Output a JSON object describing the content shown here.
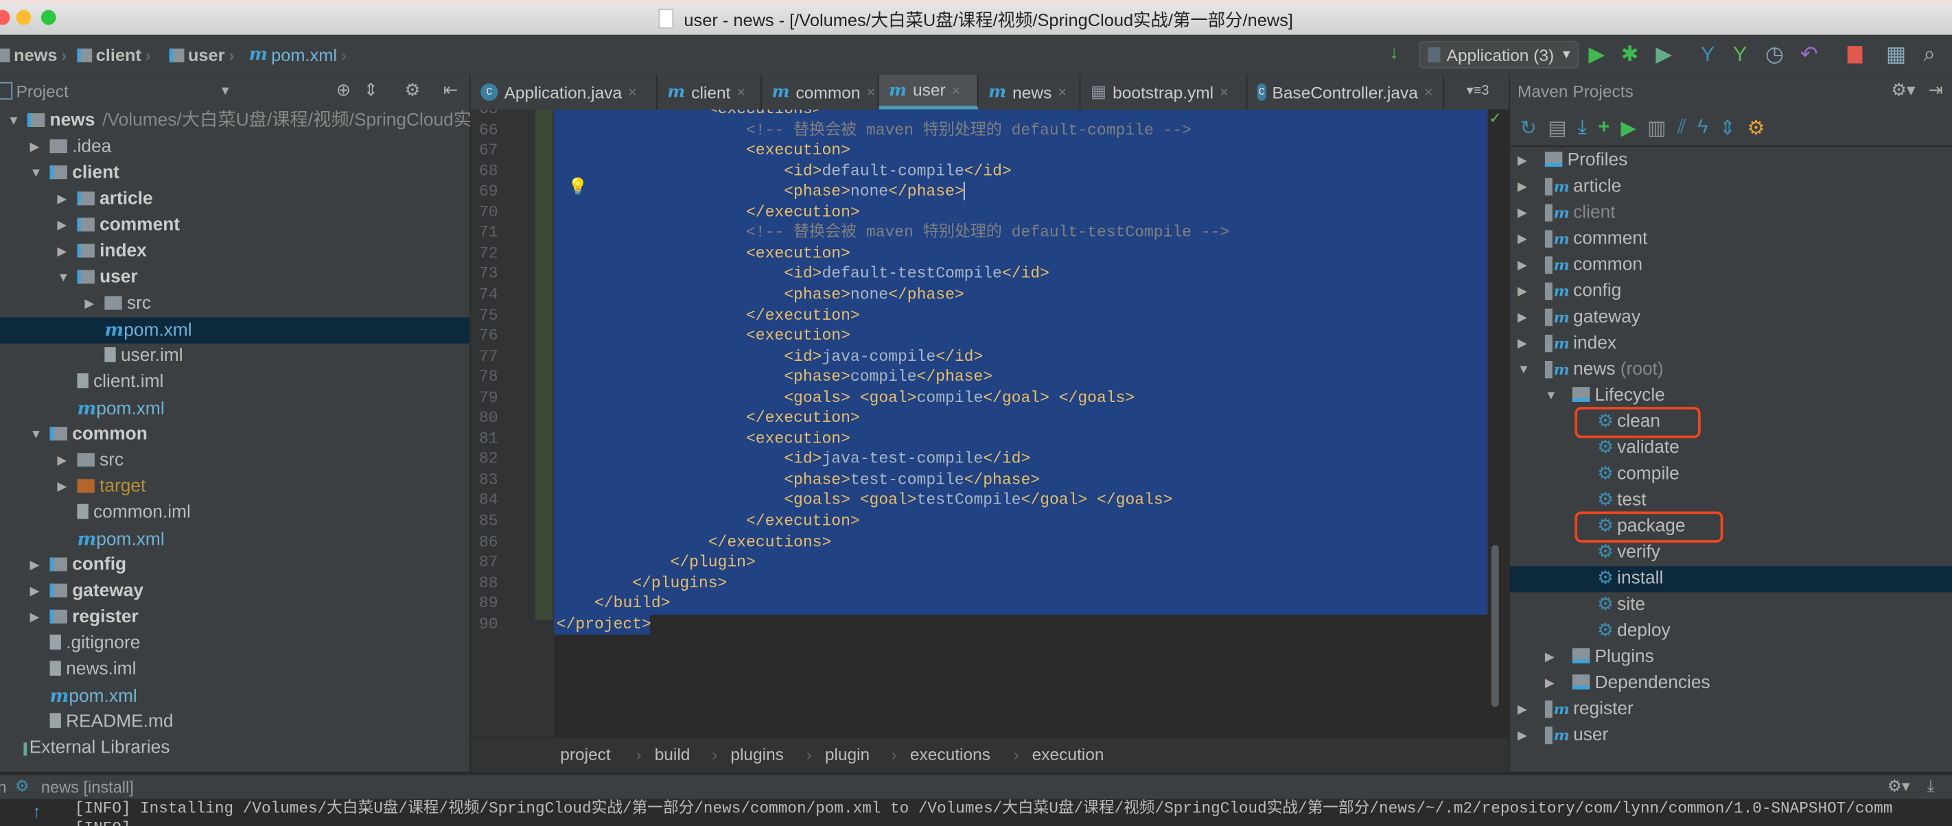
{
  "window": {
    "title": "user - news - [/Volumes/大白菜U盘/课程/视频/SpringCloud实战/第一部分/news]"
  },
  "nav": {
    "breadcrumbs": [
      "news",
      "client",
      "user",
      "pom.xml"
    ],
    "run_config": "Application (3)"
  },
  "project_panel": {
    "title": "Project",
    "tree": [
      {
        "label": "news",
        "extra": "/Volumes/大白菜U盘/课程/视频/SpringCloud实",
        "level": 0,
        "arrow": "down",
        "kind": "module"
      },
      {
        "label": ".idea",
        "level": 1,
        "arrow": "right",
        "kind": "folder"
      },
      {
        "label": "client",
        "level": 1,
        "arrow": "down",
        "kind": "module"
      },
      {
        "label": "article",
        "level": 2,
        "arrow": "right",
        "kind": "module"
      },
      {
        "label": "comment",
        "level": 2,
        "arrow": "right",
        "kind": "module"
      },
      {
        "label": "index",
        "level": 2,
        "arrow": "right",
        "kind": "module"
      },
      {
        "label": "user",
        "level": 2,
        "arrow": "down",
        "kind": "module"
      },
      {
        "label": "src",
        "level": 3,
        "arrow": "right",
        "kind": "folder"
      },
      {
        "label": "pom.xml",
        "level": 3,
        "kind": "maven",
        "selected": true
      },
      {
        "label": "user.iml",
        "level": 3,
        "kind": "file"
      },
      {
        "label": "client.iml",
        "level": 2,
        "kind": "file"
      },
      {
        "label": "pom.xml",
        "level": 2,
        "kind": "maven"
      },
      {
        "label": "common",
        "level": 1,
        "arrow": "down",
        "kind": "module"
      },
      {
        "label": "src",
        "level": 2,
        "arrow": "right",
        "kind": "folder"
      },
      {
        "label": "target",
        "level": 2,
        "arrow": "right",
        "kind": "excluded"
      },
      {
        "label": "common.iml",
        "level": 2,
        "kind": "file"
      },
      {
        "label": "pom.xml",
        "level": 2,
        "kind": "maven"
      },
      {
        "label": "config",
        "level": 1,
        "arrow": "right",
        "kind": "module"
      },
      {
        "label": "gateway",
        "level": 1,
        "arrow": "right",
        "kind": "module"
      },
      {
        "label": "register",
        "level": 1,
        "arrow": "right",
        "kind": "module"
      },
      {
        "label": ".gitignore",
        "level": 1,
        "kind": "file"
      },
      {
        "label": "news.iml",
        "level": 1,
        "kind": "file"
      },
      {
        "label": "pom.xml",
        "level": 1,
        "kind": "maven"
      },
      {
        "label": "README.md",
        "level": 1,
        "kind": "file"
      },
      {
        "label": "External Libraries",
        "level": 0,
        "kind": "lib"
      }
    ]
  },
  "tabs": [
    {
      "label": "Application.java",
      "icon": "class-icon"
    },
    {
      "label": "client",
      "icon": "maven-icon"
    },
    {
      "label": "common",
      "icon": "maven-icon"
    },
    {
      "label": "user",
      "icon": "maven-icon",
      "active": true
    },
    {
      "label": "news",
      "icon": "maven-icon"
    },
    {
      "label": "bootstrap.yml",
      "icon": "yaml-icon"
    },
    {
      "label": "BaseController.java",
      "icon": "class-icon"
    }
  ],
  "tab_overflow": "3",
  "editor": {
    "first_line": 65,
    "selected_through": 89,
    "caret_line": 69,
    "lines": [
      "                <executions>",
      "                    <!-- 替换会被 maven 特别处理的 default-compile -->",
      "                    <execution>",
      "                        <id>default-compile</id>",
      "                        <phase>none</phase>",
      "                    </execution>",
      "                    <!-- 替换会被 maven 特别处理的 default-testCompile -->",
      "                    <execution>",
      "                        <id>default-testCompile</id>",
      "                        <phase>none</phase>",
      "                    </execution>",
      "                    <execution>",
      "                        <id>java-compile</id>",
      "                        <phase>compile</phase>",
      "                        <goals> <goal>compile</goal> </goals>",
      "                    </execution>",
      "                    <execution>",
      "                        <id>java-test-compile</id>",
      "                        <phase>test-compile</phase>",
      "                        <goals> <goal>testCompile</goal> </goals>",
      "                    </execution>",
      "                </executions>",
      "            </plugin>",
      "        </plugins>",
      "    </build>",
      "</project>"
    ],
    "breadcrumb": [
      "project",
      "build",
      "plugins",
      "plugin",
      "executions",
      "execution"
    ]
  },
  "maven": {
    "title": "Maven Projects",
    "tree": [
      {
        "label": "Profiles",
        "level": 0,
        "arrow": "right",
        "kind": "profiles"
      },
      {
        "label": "article",
        "level": 0,
        "arrow": "right",
        "kind": "module"
      },
      {
        "label": "client",
        "level": 0,
        "arrow": "right",
        "kind": "module",
        "dim": true
      },
      {
        "label": "comment",
        "level": 0,
        "arrow": "right",
        "kind": "module"
      },
      {
        "label": "common",
        "level": 0,
        "arrow": "right",
        "kind": "module"
      },
      {
        "label": "config",
        "level": 0,
        "arrow": "right",
        "kind": "module"
      },
      {
        "label": "gateway",
        "level": 0,
        "arrow": "right",
        "kind": "module"
      },
      {
        "label": "index",
        "level": 0,
        "arrow": "right",
        "kind": "module"
      },
      {
        "label": "news",
        "suffix": "(root)",
        "level": 0,
        "arrow": "down",
        "kind": "module"
      },
      {
        "label": "Lifecycle",
        "level": 1,
        "arrow": "down",
        "kind": "lifecycle"
      },
      {
        "label": "clean",
        "level": 2,
        "kind": "goal",
        "highlight": true
      },
      {
        "label": "validate",
        "level": 2,
        "kind": "goal"
      },
      {
        "label": "compile",
        "level": 2,
        "kind": "goal"
      },
      {
        "label": "test",
        "level": 2,
        "kind": "goal"
      },
      {
        "label": "package",
        "level": 2,
        "kind": "goal",
        "highlight": true
      },
      {
        "label": "verify",
        "level": 2,
        "kind": "goal"
      },
      {
        "label": "install",
        "level": 2,
        "kind": "goal",
        "selected": true
      },
      {
        "label": "site",
        "level": 2,
        "kind": "goal"
      },
      {
        "label": "deploy",
        "level": 2,
        "kind": "goal"
      },
      {
        "label": "Plugins",
        "level": 1,
        "arrow": "right",
        "kind": "lifecycle"
      },
      {
        "label": "Dependencies",
        "level": 1,
        "arrow": "right",
        "kind": "lifecycle"
      },
      {
        "label": "register",
        "level": 0,
        "arrow": "right",
        "kind": "module"
      },
      {
        "label": "user",
        "level": 0,
        "arrow": "right",
        "kind": "module"
      }
    ],
    "highlight_color": "#f4461e"
  },
  "run": {
    "prefix": "n",
    "title": "news [install]",
    "console": [
      "[INFO] Installing /Volumes/大白菜U盘/课程/视频/SpringCloud实战/第一部分/news/common/pom.xml to /Volumes/大白菜U盘/课程/视频/SpringCloud实战/第一部分/news/~/.m2/repository/com/lynn/common/1.0-SNAPSHOT/comm",
      "[INFO]"
    ]
  }
}
